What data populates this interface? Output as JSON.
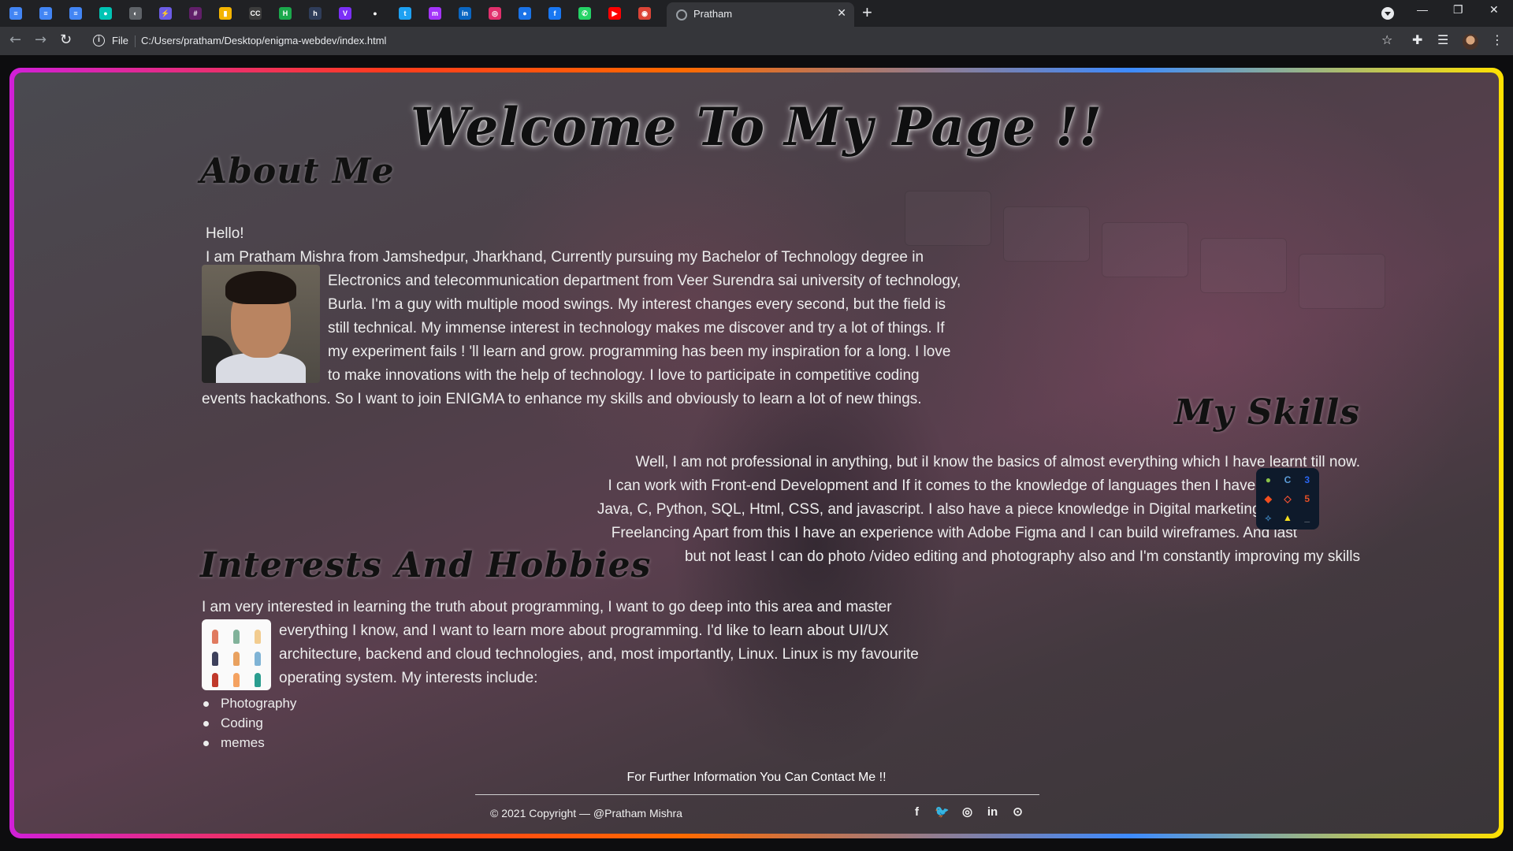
{
  "browser": {
    "tab_title": "Pratham",
    "new_tab_label": "+",
    "close_tab_label": "✕",
    "address_scheme_label": "File",
    "url": "C:/Users/pratham/Desktop/enigma-webdev/index.html",
    "window_controls": {
      "minimize": "—",
      "restore": "❐",
      "close": "✕"
    },
    "pinned_tabs": [
      {
        "icon": "google-docs-icon",
        "color": "#4285f4",
        "glyph": "≡"
      },
      {
        "icon": "google-docs-icon",
        "color": "#4285f4",
        "glyph": "≡"
      },
      {
        "icon": "google-docs-icon",
        "color": "#4285f4",
        "glyph": "≡"
      },
      {
        "icon": "meet-icon",
        "color": "#00c4b4",
        "glyph": "●"
      },
      {
        "icon": "globe-icon",
        "color": "#5f6368",
        "glyph": "◐"
      },
      {
        "icon": "bolt-icon",
        "color": "#6c5ce7",
        "glyph": "⚡"
      },
      {
        "icon": "slack-icon",
        "color": "#611f69",
        "glyph": "#"
      },
      {
        "icon": "analytics-icon",
        "color": "#f4b400",
        "glyph": "▮"
      },
      {
        "icon": "cc-icon",
        "color": "#3c3c3c",
        "glyph": "CC"
      },
      {
        "icon": "hackerrank-icon",
        "color": "#1ba94c",
        "glyph": "H"
      },
      {
        "icon": "hashnode-icon",
        "color": "#2f3d5a",
        "glyph": "h"
      },
      {
        "icon": "v-icon",
        "color": "#7b2ff7",
        "glyph": "V"
      },
      {
        "icon": "github-icon",
        "color": "#202124",
        "glyph": "●"
      },
      {
        "icon": "twitter-icon",
        "color": "#1da1f2",
        "glyph": "t"
      },
      {
        "icon": "messenger-icon",
        "color": "#a334fa",
        "glyph": "m"
      },
      {
        "icon": "linkedin-icon",
        "color": "#0a66c2",
        "glyph": "in"
      },
      {
        "icon": "instagram-icon",
        "color": "#e1306c",
        "glyph": "◎"
      },
      {
        "icon": "messages-icon",
        "color": "#1a73e8",
        "glyph": "●"
      },
      {
        "icon": "facebook-icon",
        "color": "#1877f2",
        "glyph": "f"
      },
      {
        "icon": "whatsapp-icon",
        "color": "#25d366",
        "glyph": "✆"
      },
      {
        "icon": "youtube-icon",
        "color": "#ff0000",
        "glyph": "▶"
      },
      {
        "icon": "chrome-icon",
        "color": "#db4437",
        "glyph": "◉"
      }
    ]
  },
  "page": {
    "title": "Welcome To My Page !!",
    "about": {
      "heading": "About Me",
      "greeting": "Hello!",
      "line1": "I am Pratham Mishra from Jamshedpur, Jharkhand, Currently pursuing my Bachelor of Technology degree in",
      "wrap_lines": [
        "Electronics and telecommunication department from Veer Surendra sai university of technology,",
        "Burla. I'm a guy with multiple mood swings. My interest changes every second, but the field is",
        "still technical. My immense interest in technology makes me discover and try a lot of things. If",
        "my experiment fails ! 'll learn and grow. programming has been my inspiration for a long. I love",
        "to make innovations with the help of technology. I love to participate in competitive coding"
      ],
      "last_line": "events hackathons. So I want to join ENIGMA to enhance my skills and obviously to learn a lot of new things."
    },
    "skills": {
      "heading": "My Skills",
      "lines": [
        "Well, I am not professional in anything, but iI know the basics of almost everything which I have learnt till now.",
        "I can work with Front-end Development and If it comes to the knowledge of languages then I have learnt",
        "Java, C, Python, SQL, Html, CSS, and javascript. I also have a piece knowledge in Digital marketings and",
        "Freelancing Apart from this I have an experience with Adobe Figma and I can build wireframes. And last",
        "but not least I can do photo /video editing and photography also and I'm constantly improving my skills"
      ]
    },
    "interests": {
      "heading": "Interests And Hobbies",
      "line1": "I am very interested in learning the truth about programming, I want to go deep into this area and master",
      "wrap_lines": [
        "everything I know, and I want to learn more about programming. I'd like to learn about UI/UX",
        "architecture, backend and cloud technologies, and, most importantly, Linux. Linux is my favourite",
        "operating system. My interests include:"
      ],
      "items": [
        "Photography",
        "Coding",
        "memes"
      ]
    },
    "footer": {
      "contact": "For Further Information You Can Contact Me !!",
      "copyright": "© 2021 Copyright —  @Pratham Mishra",
      "social": [
        {
          "icon": "facebook-icon",
          "glyph": "f"
        },
        {
          "icon": "twitter-icon",
          "glyph": "🐦"
        },
        {
          "icon": "instagram-icon",
          "glyph": "◎"
        },
        {
          "icon": "linkedin-icon",
          "glyph": "in"
        },
        {
          "icon": "github-icon",
          "glyph": "⊙"
        }
      ]
    }
  }
}
